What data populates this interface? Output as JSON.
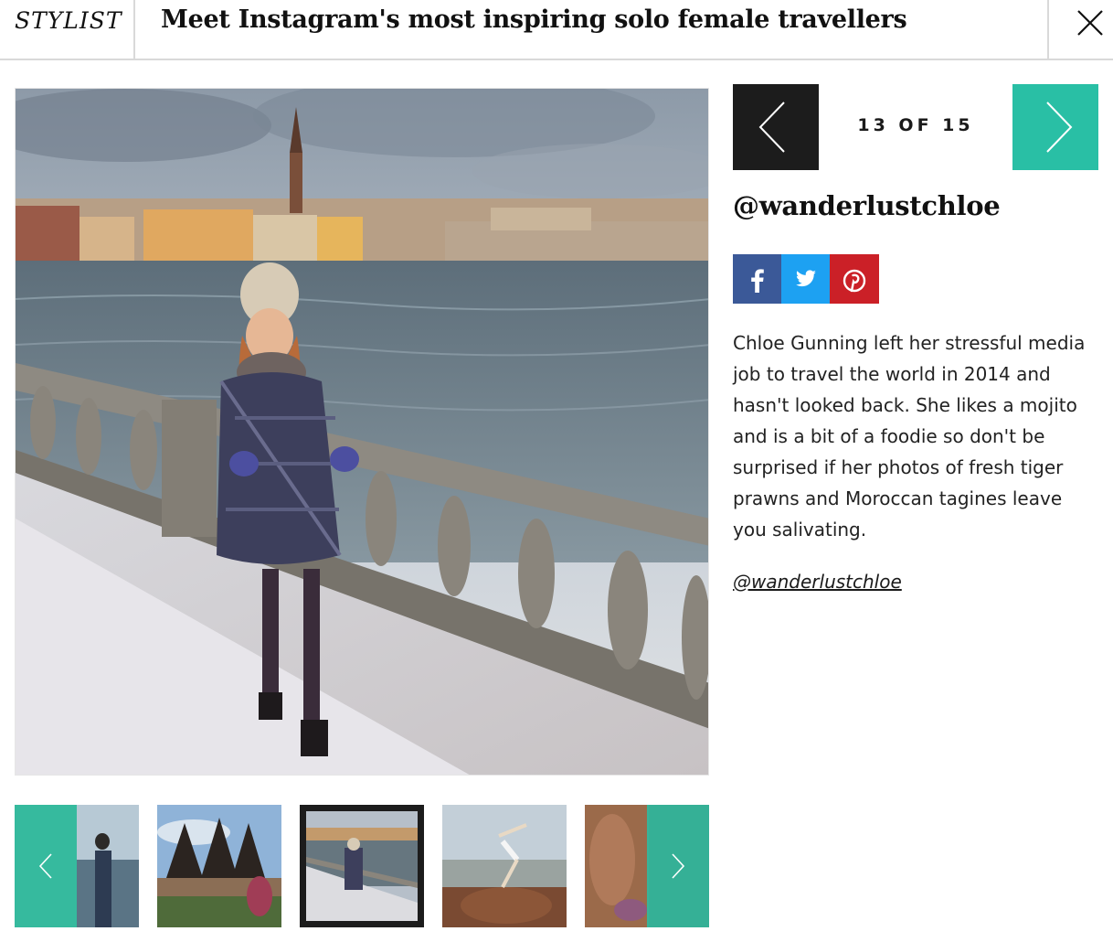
{
  "header": {
    "logo": "STYLIST",
    "title": "Meet Instagram's most inspiring solo female travellers",
    "close_icon": "close-icon"
  },
  "slide": {
    "counter": "13 OF 15",
    "handle": "@wanderlustchloe",
    "description": "Chloe Gunning left her stressful media job to travel the world in 2014 and hasn't looked back. She likes a mojito and is a bit of a foodie so don't be surprised if her photos of fresh tiger prawns and Moroccan tagines leave you salivating.",
    "link": "@wanderlustchloe"
  },
  "share": [
    {
      "network": "facebook",
      "icon": "facebook-icon",
      "color": "#3b5998"
    },
    {
      "network": "twitter",
      "icon": "twitter-icon",
      "color": "#1da1f2"
    },
    {
      "network": "pinterest",
      "icon": "pinterest-icon",
      "color": "#cb2027"
    }
  ],
  "colors": {
    "accent": "#29bfa5",
    "dark": "#1c1c1c"
  },
  "thumbnails": [
    {
      "subject": "woman by lake"
    },
    {
      "subject": "pagoda temple"
    },
    {
      "subject": "snowy waterfront",
      "selected": true
    },
    {
      "subject": "yoga on rock"
    },
    {
      "subject": "autumn forest"
    }
  ]
}
